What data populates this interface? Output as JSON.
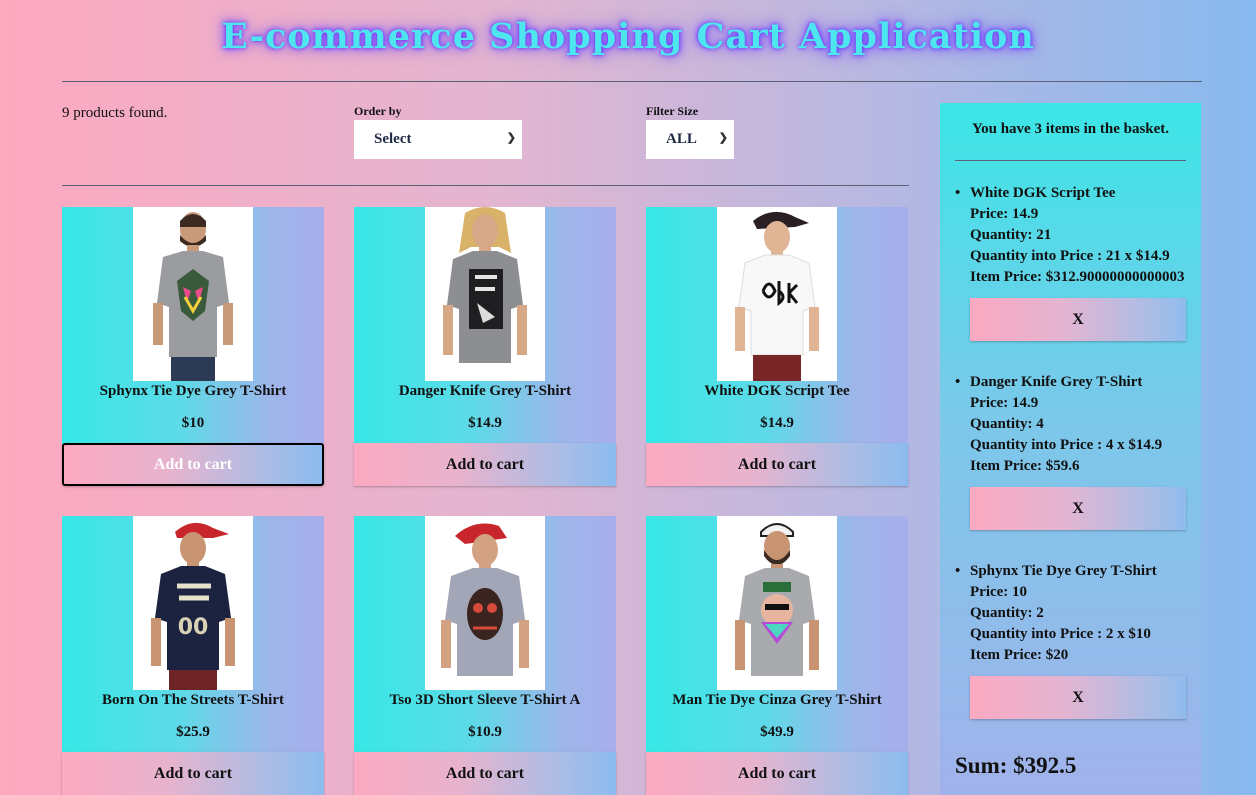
{
  "title": "E-commerce Shopping Cart Application",
  "products_found": "9 products found.",
  "filters": {
    "order_label": "Order by",
    "order_value": "Select",
    "size_label": "Filter Size",
    "size_value": "ALL"
  },
  "products": [
    {
      "name": "Sphynx Tie Dye Grey T-Shirt",
      "price": "$10",
      "button": "Add to cart"
    },
    {
      "name": "Danger Knife Grey T-Shirt",
      "price": "$14.9",
      "button": "Add to cart"
    },
    {
      "name": "White DGK Script Tee",
      "price": "$14.9",
      "button": "Add to cart"
    },
    {
      "name": "Born On The Streets T-Shirt",
      "price": "$25.9",
      "button": "Add to cart"
    },
    {
      "name": "Tso 3D Short Sleeve T-Shirt A",
      "price": "$10.9",
      "button": "Add to cart"
    },
    {
      "name": "Man Tie Dye Cinza Grey T-Shirt",
      "price": "$49.9",
      "button": "Add to cart"
    }
  ],
  "cart": {
    "header": "You have 3 items in the basket.",
    "items": [
      {
        "name": "White DGK Script Tee",
        "price": "Price: 14.9",
        "quantity": "Quantity: 21",
        "qxp": "Quantity into Price : 21 x $14.9",
        "item_price": "Item Price: $312.90000000000003",
        "remove": "X"
      },
      {
        "name": "Danger Knife Grey T-Shirt",
        "price": "Price: 14.9",
        "quantity": "Quantity: 4",
        "qxp": "Quantity into Price : 4 x $14.9",
        "item_price": "Item Price: $59.6",
        "remove": "X"
      },
      {
        "name": "Sphynx Tie Dye Grey T-Shirt",
        "price": "Price: 10",
        "quantity": "Quantity: 2",
        "qxp": "Quantity into Price : 2 x $10",
        "item_price": "Item Price: $20",
        "remove": "X"
      }
    ],
    "sum": "Sum: $392.5"
  },
  "colors": {
    "title": "#4ee6ee",
    "title_glow": "#7a48ff",
    "card_left": "#37e8e6",
    "card_right": "#a7aeeb",
    "button_left": "#fca9c1",
    "button_right": "#8bbbef"
  }
}
